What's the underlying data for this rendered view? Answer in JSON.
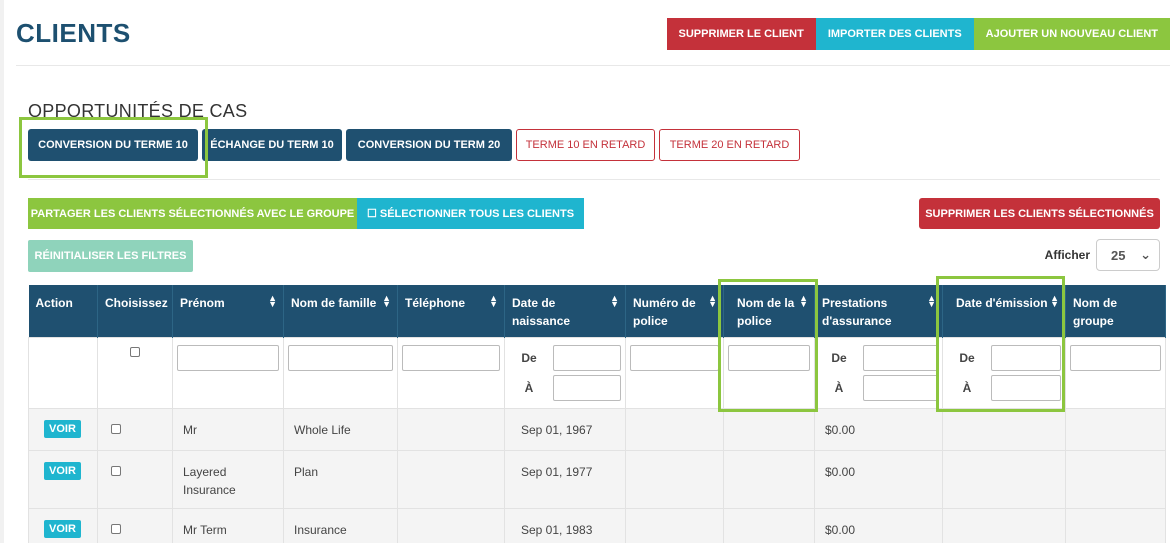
{
  "page_title": "CLIENTS",
  "top_buttons": {
    "delete": "SUPPRIMER LE CLIENT",
    "import": "IMPORTER DES CLIENTS",
    "add": "AJOUTER UN NOUVEAU CLIENT"
  },
  "opportunities": {
    "title": "OPPORTUNITÉS DE CAS",
    "buttons": [
      "CONVERSION DU TERME 10",
      "ÉCHANGE DU TERM 10",
      "CONVERSION DU TERM 20",
      "TERME 10 EN RETARD",
      "TERME 20 EN RETARD"
    ]
  },
  "actions": {
    "share": "PARTAGER LES CLIENTS SÉLECTIONNÉS AVEC LE GROUPE",
    "select_all": "☐ SÉLECTIONNER TOUS LES CLIENTS",
    "delete_selected": "SUPPRIMER LES CLIENTS SÉLECTIONNÉS",
    "reset_filters": "RÉINITIALISER LES FILTRES"
  },
  "page_size": {
    "label": "Afficher",
    "value": "25"
  },
  "table": {
    "headers": {
      "action": "Action",
      "choose": "Choisissez",
      "first_name": "Prénom",
      "last_name": "Nom de famille",
      "phone": "Téléphone",
      "birth_date": "Date de naissance",
      "policy_number": "Numéro de police",
      "policy_name": "Nom de la police",
      "benefits": "Prestations d'assurance",
      "issue_date": "Date d'émission",
      "group_name": "Nom de groupe"
    },
    "range_from": "De",
    "range_to": "À",
    "view_label": "VOIR",
    "rows": [
      {
        "first_name": "Mr",
        "last_name": "Whole Life",
        "phone": "",
        "birth_date": "Sep 01, 1967",
        "policy_number": "",
        "policy_name": "",
        "benefits": "$0.00",
        "issue_date": "",
        "group_name": ""
      },
      {
        "first_name": "Layered Insurance",
        "last_name": "Plan",
        "phone": "",
        "birth_date": "Sep 01, 1977",
        "policy_number": "",
        "policy_name": "",
        "benefits": "$0.00",
        "issue_date": "",
        "group_name": ""
      },
      {
        "first_name": "Mr Term",
        "last_name": "Insurance",
        "phone": "",
        "birth_date": "Sep 01, 1983",
        "policy_number": "",
        "policy_name": "",
        "benefits": "$0.00",
        "issue_date": "",
        "group_name": ""
      }
    ]
  },
  "colors": {
    "navy": "#1f5070",
    "red": "#c4313a",
    "cyan": "#1fb5cf",
    "green": "#8cc63f",
    "highlight": "#8cc63f"
  }
}
